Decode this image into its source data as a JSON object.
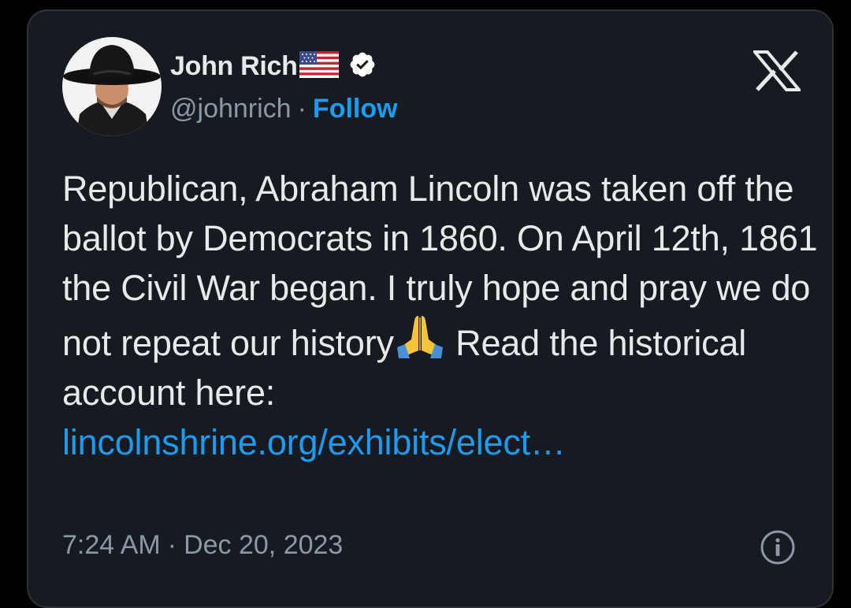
{
  "author": {
    "name": "John Rich",
    "handle": "@johnrich",
    "separator": "·",
    "follow_label": "Follow",
    "flag_icon": "us-flag-icon",
    "verified_icon": "verified-badge-icon"
  },
  "tweet": {
    "text_before_emoji": "Republican, Abraham Lincoln was taken off the ballot by Democrats in 1860. On April 12th, 1861 the Civil War began.  I truly hope and pray we do not repeat our history",
    "emoji": "🙏",
    "text_after_emoji": " Read the historical account here: ",
    "link": "lincolnshrine.org/exhibits/elect…"
  },
  "meta": {
    "time": "7:24 AM",
    "separator": "·",
    "date": "Dec 20, 2023"
  },
  "icons": {
    "platform": "x-logo-icon",
    "info": "info-icon"
  },
  "colors": {
    "background": "#000000",
    "card": "#161b22",
    "text": "#e7e9ea",
    "muted": "#8b98a5",
    "accent": "#1d9bf0",
    "verified": "#ffffff"
  }
}
